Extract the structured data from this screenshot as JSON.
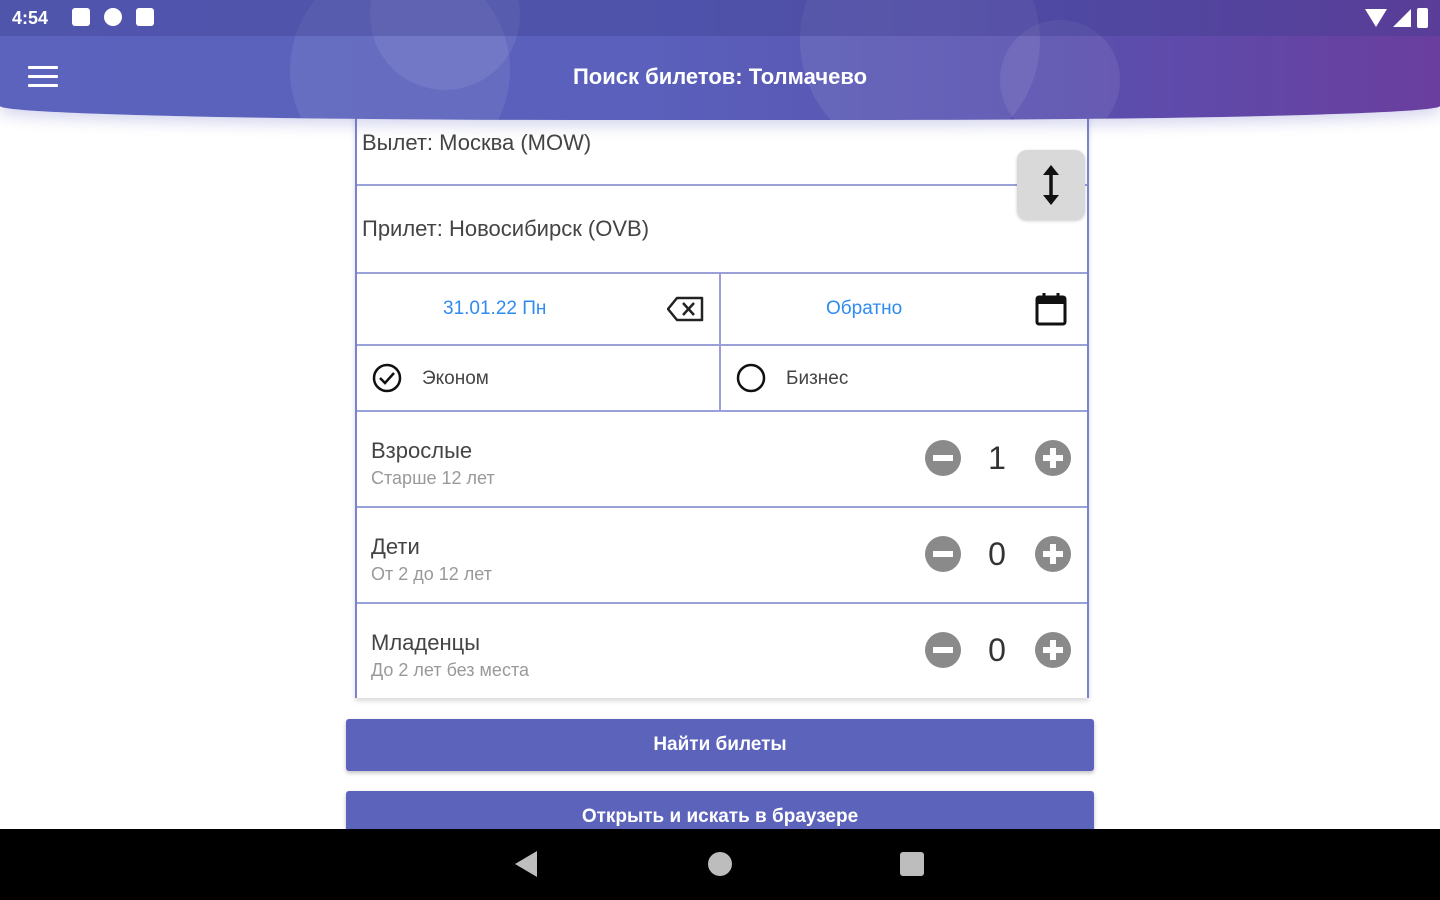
{
  "status_bar": {
    "time": "4:54",
    "icons_left": [
      "notification-a-icon",
      "notification-p-icon",
      "sd-card-icon"
    ],
    "icons_right": [
      "wifi-icon",
      "signal-icon",
      "battery-icon"
    ]
  },
  "app_bar": {
    "title": "Поиск билетов: Толмачево",
    "menu_icon": "hamburger-menu-icon",
    "colors": {
      "gradient_start": "#5b63bd",
      "gradient_end": "#6a3e9e"
    }
  },
  "search_form": {
    "departure": "Вылет: Москва (MOW)",
    "arrival": "Прилет: Новосибирск (OVB)",
    "swap_icon": "swap-vertical-icon",
    "depart_date": "31.01.22 Пн",
    "clear_date_icon": "backspace-clear-icon",
    "return_date": "Обратно",
    "calendar_icon": "calendar-icon",
    "classes": [
      {
        "label": "Эконом",
        "selected": true
      },
      {
        "label": "Бизнес",
        "selected": false
      }
    ],
    "passengers": [
      {
        "title": "Взрослые",
        "subtitle": "Старше 12 лет",
        "count": "1"
      },
      {
        "title": "Дети",
        "subtitle": "От 2 до 12 лет",
        "count": "0"
      },
      {
        "title": "Младенцы",
        "subtitle": "До 2 лет без места",
        "count": "0"
      }
    ],
    "accent_color": "#2e8bf0"
  },
  "buttons": {
    "find": "Найти билеты",
    "open_browser": "Открыть и искать в браузере",
    "color": "#5c63bb"
  },
  "nav_bar": {
    "back_icon": "back-triangle-icon",
    "home_icon": "home-circle-icon",
    "recents_icon": "recents-square-icon"
  }
}
